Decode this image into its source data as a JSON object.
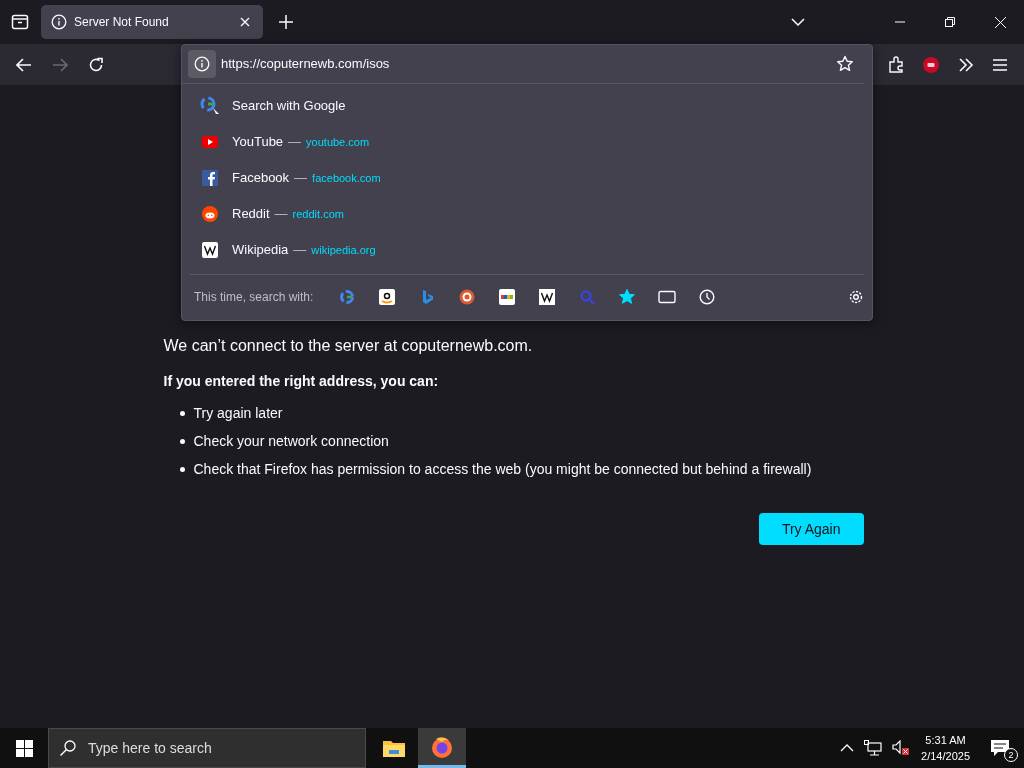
{
  "tabs": [
    {
      "label": "Server Not Found",
      "selected": true
    }
  ],
  "toolbar": {
    "back_disabled": false,
    "forward_disabled": true
  },
  "address_bar": {
    "value": "https://coputernewb.com/isos"
  },
  "suggestions": [
    {
      "kind": "search",
      "title": "Search with Google"
    },
    {
      "kind": "site",
      "title": "YouTube",
      "separator": "—",
      "url": "youtube.com"
    },
    {
      "kind": "site",
      "title": "Facebook",
      "separator": "—",
      "url": "facebook.com"
    },
    {
      "kind": "site",
      "title": "Reddit",
      "separator": "—",
      "url": "reddit.com"
    },
    {
      "kind": "site",
      "title": "Wikipedia",
      "separator": "—",
      "url": "wikipedia.org"
    }
  ],
  "search_with": {
    "label": "This time, search with:"
  },
  "page": {
    "message": "We can’t connect to the server at coputernewb.com.",
    "advice_title": "If you entered the right address, you can:",
    "advice": [
      "Try again later",
      "Check your network connection",
      "Check that Firefox has permission to access the web (you might be connected but behind a firewall)"
    ],
    "button": "Try Again"
  },
  "taskbar": {
    "search_placeholder": "Type here to search",
    "time": "5:31 AM",
    "date": "2/14/2025",
    "notifications": "2"
  }
}
